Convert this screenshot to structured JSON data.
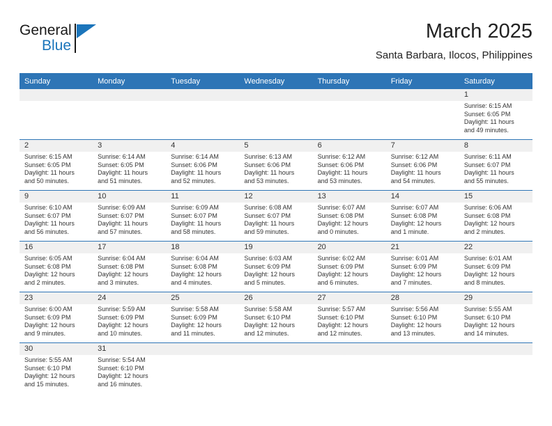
{
  "brand": {
    "name_top": "General",
    "name_bottom": "Blue",
    "accent_color": "#1b75bb"
  },
  "header": {
    "title": "March 2025",
    "subtitle": "Santa Barbara, Ilocos, Philippines"
  },
  "calendar": {
    "header_bg": "#2e75b6",
    "daynum_bg": "#f0f0f0",
    "weekday_headers": [
      "Sunday",
      "Monday",
      "Tuesday",
      "Wednesday",
      "Thursday",
      "Friday",
      "Saturday"
    ],
    "labels": {
      "sunrise": "Sunrise:",
      "sunset": "Sunset:",
      "daylight": "Daylight:"
    },
    "weeks": [
      [
        {
          "day": "",
          "sunrise": "",
          "sunset": "",
          "daylight_line1": "",
          "daylight_line2": ""
        },
        {
          "day": "",
          "sunrise": "",
          "sunset": "",
          "daylight_line1": "",
          "daylight_line2": ""
        },
        {
          "day": "",
          "sunrise": "",
          "sunset": "",
          "daylight_line1": "",
          "daylight_line2": ""
        },
        {
          "day": "",
          "sunrise": "",
          "sunset": "",
          "daylight_line1": "",
          "daylight_line2": ""
        },
        {
          "day": "",
          "sunrise": "",
          "sunset": "",
          "daylight_line1": "",
          "daylight_line2": ""
        },
        {
          "day": "",
          "sunrise": "",
          "sunset": "",
          "daylight_line1": "",
          "daylight_line2": ""
        },
        {
          "day": "1",
          "sunrise": "Sunrise: 6:15 AM",
          "sunset": "Sunset: 6:05 PM",
          "daylight_line1": "Daylight: 11 hours",
          "daylight_line2": "and 49 minutes."
        }
      ],
      [
        {
          "day": "2",
          "sunrise": "Sunrise: 6:15 AM",
          "sunset": "Sunset: 6:05 PM",
          "daylight_line1": "Daylight: 11 hours",
          "daylight_line2": "and 50 minutes."
        },
        {
          "day": "3",
          "sunrise": "Sunrise: 6:14 AM",
          "sunset": "Sunset: 6:05 PM",
          "daylight_line1": "Daylight: 11 hours",
          "daylight_line2": "and 51 minutes."
        },
        {
          "day": "4",
          "sunrise": "Sunrise: 6:14 AM",
          "sunset": "Sunset: 6:06 PM",
          "daylight_line1": "Daylight: 11 hours",
          "daylight_line2": "and 52 minutes."
        },
        {
          "day": "5",
          "sunrise": "Sunrise: 6:13 AM",
          "sunset": "Sunset: 6:06 PM",
          "daylight_line1": "Daylight: 11 hours",
          "daylight_line2": "and 53 minutes."
        },
        {
          "day": "6",
          "sunrise": "Sunrise: 6:12 AM",
          "sunset": "Sunset: 6:06 PM",
          "daylight_line1": "Daylight: 11 hours",
          "daylight_line2": "and 53 minutes."
        },
        {
          "day": "7",
          "sunrise": "Sunrise: 6:12 AM",
          "sunset": "Sunset: 6:06 PM",
          "daylight_line1": "Daylight: 11 hours",
          "daylight_line2": "and 54 minutes."
        },
        {
          "day": "8",
          "sunrise": "Sunrise: 6:11 AM",
          "sunset": "Sunset: 6:07 PM",
          "daylight_line1": "Daylight: 11 hours",
          "daylight_line2": "and 55 minutes."
        }
      ],
      [
        {
          "day": "9",
          "sunrise": "Sunrise: 6:10 AM",
          "sunset": "Sunset: 6:07 PM",
          "daylight_line1": "Daylight: 11 hours",
          "daylight_line2": "and 56 minutes."
        },
        {
          "day": "10",
          "sunrise": "Sunrise: 6:09 AM",
          "sunset": "Sunset: 6:07 PM",
          "daylight_line1": "Daylight: 11 hours",
          "daylight_line2": "and 57 minutes."
        },
        {
          "day": "11",
          "sunrise": "Sunrise: 6:09 AM",
          "sunset": "Sunset: 6:07 PM",
          "daylight_line1": "Daylight: 11 hours",
          "daylight_line2": "and 58 minutes."
        },
        {
          "day": "12",
          "sunrise": "Sunrise: 6:08 AM",
          "sunset": "Sunset: 6:07 PM",
          "daylight_line1": "Daylight: 11 hours",
          "daylight_line2": "and 59 minutes."
        },
        {
          "day": "13",
          "sunrise": "Sunrise: 6:07 AM",
          "sunset": "Sunset: 6:08 PM",
          "daylight_line1": "Daylight: 12 hours",
          "daylight_line2": "and 0 minutes."
        },
        {
          "day": "14",
          "sunrise": "Sunrise: 6:07 AM",
          "sunset": "Sunset: 6:08 PM",
          "daylight_line1": "Daylight: 12 hours",
          "daylight_line2": "and 1 minute."
        },
        {
          "day": "15",
          "sunrise": "Sunrise: 6:06 AM",
          "sunset": "Sunset: 6:08 PM",
          "daylight_line1": "Daylight: 12 hours",
          "daylight_line2": "and 2 minutes."
        }
      ],
      [
        {
          "day": "16",
          "sunrise": "Sunrise: 6:05 AM",
          "sunset": "Sunset: 6:08 PM",
          "daylight_line1": "Daylight: 12 hours",
          "daylight_line2": "and 2 minutes."
        },
        {
          "day": "17",
          "sunrise": "Sunrise: 6:04 AM",
          "sunset": "Sunset: 6:08 PM",
          "daylight_line1": "Daylight: 12 hours",
          "daylight_line2": "and 3 minutes."
        },
        {
          "day": "18",
          "sunrise": "Sunrise: 6:04 AM",
          "sunset": "Sunset: 6:08 PM",
          "daylight_line1": "Daylight: 12 hours",
          "daylight_line2": "and 4 minutes."
        },
        {
          "day": "19",
          "sunrise": "Sunrise: 6:03 AM",
          "sunset": "Sunset: 6:09 PM",
          "daylight_line1": "Daylight: 12 hours",
          "daylight_line2": "and 5 minutes."
        },
        {
          "day": "20",
          "sunrise": "Sunrise: 6:02 AM",
          "sunset": "Sunset: 6:09 PM",
          "daylight_line1": "Daylight: 12 hours",
          "daylight_line2": "and 6 minutes."
        },
        {
          "day": "21",
          "sunrise": "Sunrise: 6:01 AM",
          "sunset": "Sunset: 6:09 PM",
          "daylight_line1": "Daylight: 12 hours",
          "daylight_line2": "and 7 minutes."
        },
        {
          "day": "22",
          "sunrise": "Sunrise: 6:01 AM",
          "sunset": "Sunset: 6:09 PM",
          "daylight_line1": "Daylight: 12 hours",
          "daylight_line2": "and 8 minutes."
        }
      ],
      [
        {
          "day": "23",
          "sunrise": "Sunrise: 6:00 AM",
          "sunset": "Sunset: 6:09 PM",
          "daylight_line1": "Daylight: 12 hours",
          "daylight_line2": "and 9 minutes."
        },
        {
          "day": "24",
          "sunrise": "Sunrise: 5:59 AM",
          "sunset": "Sunset: 6:09 PM",
          "daylight_line1": "Daylight: 12 hours",
          "daylight_line2": "and 10 minutes."
        },
        {
          "day": "25",
          "sunrise": "Sunrise: 5:58 AM",
          "sunset": "Sunset: 6:09 PM",
          "daylight_line1": "Daylight: 12 hours",
          "daylight_line2": "and 11 minutes."
        },
        {
          "day": "26",
          "sunrise": "Sunrise: 5:58 AM",
          "sunset": "Sunset: 6:10 PM",
          "daylight_line1": "Daylight: 12 hours",
          "daylight_line2": "and 12 minutes."
        },
        {
          "day": "27",
          "sunrise": "Sunrise: 5:57 AM",
          "sunset": "Sunset: 6:10 PM",
          "daylight_line1": "Daylight: 12 hours",
          "daylight_line2": "and 12 minutes."
        },
        {
          "day": "28",
          "sunrise": "Sunrise: 5:56 AM",
          "sunset": "Sunset: 6:10 PM",
          "daylight_line1": "Daylight: 12 hours",
          "daylight_line2": "and 13 minutes."
        },
        {
          "day": "29",
          "sunrise": "Sunrise: 5:55 AM",
          "sunset": "Sunset: 6:10 PM",
          "daylight_line1": "Daylight: 12 hours",
          "daylight_line2": "and 14 minutes."
        }
      ],
      [
        {
          "day": "30",
          "sunrise": "Sunrise: 5:55 AM",
          "sunset": "Sunset: 6:10 PM",
          "daylight_line1": "Daylight: 12 hours",
          "daylight_line2": "and 15 minutes."
        },
        {
          "day": "31",
          "sunrise": "Sunrise: 5:54 AM",
          "sunset": "Sunset: 6:10 PM",
          "daylight_line1": "Daylight: 12 hours",
          "daylight_line2": "and 16 minutes."
        },
        {
          "day": "",
          "sunrise": "",
          "sunset": "",
          "daylight_line1": "",
          "daylight_line2": ""
        },
        {
          "day": "",
          "sunrise": "",
          "sunset": "",
          "daylight_line1": "",
          "daylight_line2": ""
        },
        {
          "day": "",
          "sunrise": "",
          "sunset": "",
          "daylight_line1": "",
          "daylight_line2": ""
        },
        {
          "day": "",
          "sunrise": "",
          "sunset": "",
          "daylight_line1": "",
          "daylight_line2": ""
        },
        {
          "day": "",
          "sunrise": "",
          "sunset": "",
          "daylight_line1": "",
          "daylight_line2": ""
        }
      ]
    ]
  }
}
